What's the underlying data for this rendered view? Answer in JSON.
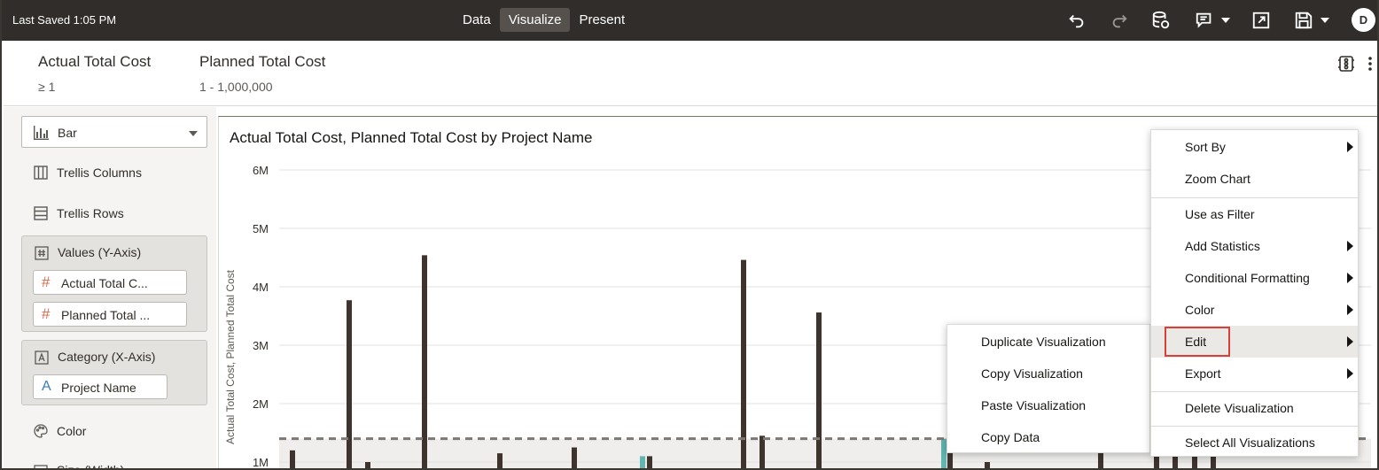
{
  "topbar": {
    "last_saved": "Last Saved 1:05 PM",
    "tabs": [
      {
        "label": "Data",
        "active": false
      },
      {
        "label": "Visualize",
        "active": true
      },
      {
        "label": "Present",
        "active": false
      }
    ],
    "icons": [
      "undo-icon",
      "redo-icon",
      "data-refresh-icon",
      "comment-icon",
      "expand-icon",
      "save-icon"
    ],
    "avatar": "D"
  },
  "filters": [
    {
      "name": "Actual Total Cost",
      "value": "≥ 1"
    },
    {
      "name": "Planned Total Cost",
      "value": "1 - 1,000,000"
    }
  ],
  "left_panel": {
    "chart_type": "Bar",
    "trellis_columns": "Trellis Columns",
    "trellis_rows": "Trellis Rows",
    "values_section": {
      "title": "Values (Y-Axis)",
      "items": [
        "Actual Total C...",
        "Planned Total ..."
      ]
    },
    "category_section": {
      "title": "Category (X-Axis)",
      "items": [
        "Project Name"
      ]
    },
    "color": "Color",
    "size_partial": "Size (Width)"
  },
  "chart": {
    "title": "Actual Total Cost, Planned Total Cost by Project Name",
    "ylabel": "Actual Total Cost, Planned Total Cost"
  },
  "chart_data": {
    "type": "bar",
    "title": "Actual Total Cost, Planned Total Cost by Project Name",
    "ylabel": "Actual Total Cost, Planned Total Cost",
    "xlabel": "",
    "y_ticks": [
      "1M",
      "2M",
      "3M",
      "4M",
      "5M",
      "6M"
    ],
    "ylim": [
      0,
      6000000
    ],
    "reference_line_value": 1400000,
    "series": [
      {
        "name": "Actual Total Cost",
        "color": "#3f332d"
      },
      {
        "name": "Planned Total Cost",
        "color": "#62b5b0"
      }
    ],
    "bars": [
      {
        "x": 327,
        "value": 1200000,
        "series": 0
      },
      {
        "x": 391,
        "value": 3770000,
        "series": 0
      },
      {
        "x": 412,
        "value": 1000000,
        "series": 0
      },
      {
        "x": 476,
        "value": 4540000,
        "series": 0
      },
      {
        "x": 561,
        "value": 1150000,
        "series": 0
      },
      {
        "x": 645,
        "value": 1250000,
        "series": 0
      },
      {
        "x": 722,
        "value": 1100000,
        "series": 1
      },
      {
        "x": 730,
        "value": 1100000,
        "series": 0
      },
      {
        "x": 836,
        "value": 4460000,
        "series": 0
      },
      {
        "x": 857,
        "value": 1450000,
        "series": 0
      },
      {
        "x": 921,
        "value": 3560000,
        "series": 0
      },
      {
        "x": 1062,
        "value": 1400000,
        "series": 1
      },
      {
        "x": 1069,
        "value": 1200000,
        "series": 0
      },
      {
        "x": 1111,
        "value": 1000000,
        "series": 0
      },
      {
        "x": 1239,
        "value": 1200000,
        "series": 0
      },
      {
        "x": 1302,
        "value": 1200000,
        "series": 0
      },
      {
        "x": 1323,
        "value": 1100000,
        "series": 0
      },
      {
        "x": 1345,
        "value": 1100000,
        "series": 0
      },
      {
        "x": 1366,
        "value": 1100000,
        "series": 0
      }
    ]
  },
  "context_menu": {
    "items": [
      {
        "label": "Sort By",
        "submenu": true
      },
      {
        "label": "Zoom Chart",
        "submenu": false
      },
      {
        "label": "Use as Filter",
        "submenu": false
      },
      {
        "label": "Add Statistics",
        "submenu": true
      },
      {
        "label": "Conditional Formatting",
        "submenu": true
      },
      {
        "label": "Color",
        "submenu": true
      },
      {
        "label": "Edit",
        "submenu": true,
        "highlighted": true
      },
      {
        "label": "Export",
        "submenu": true
      },
      {
        "label": "Delete Visualization",
        "submenu": false
      },
      {
        "label": "Select All Visualizations",
        "submenu": false
      }
    ]
  },
  "edit_submenu": {
    "items": [
      "Duplicate Visualization",
      "Copy Visualization",
      "Paste Visualization",
      "Copy Data"
    ]
  }
}
